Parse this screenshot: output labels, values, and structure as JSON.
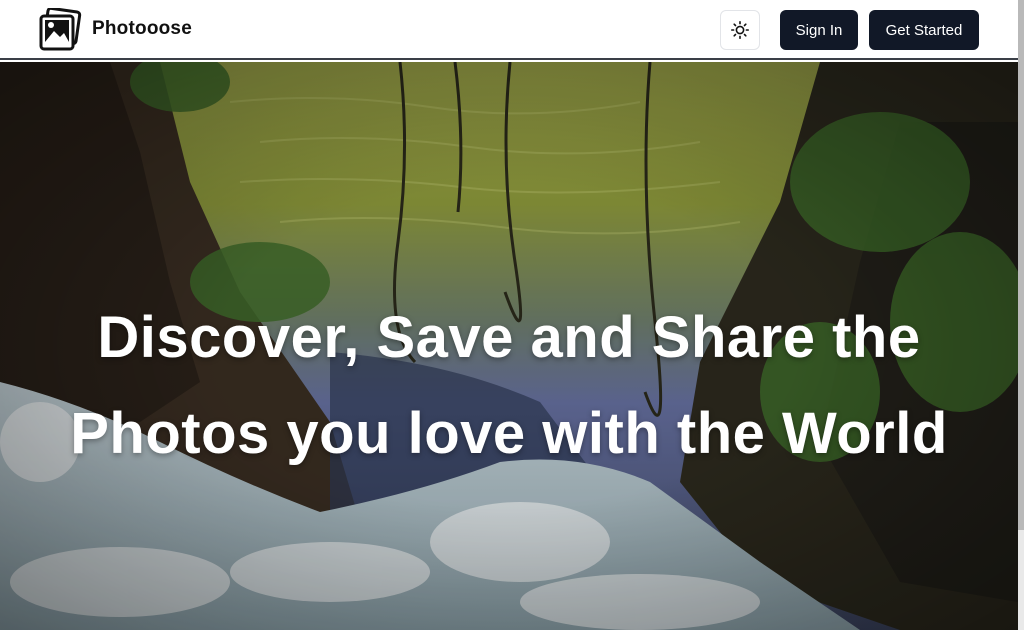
{
  "header": {
    "brand": "Photooose",
    "logo_icon": "photos-icon",
    "theme_icon": "sun-icon",
    "sign_in_label": "Sign In",
    "get_started_label": "Get Started"
  },
  "hero": {
    "headline_line1": "Discover, Save and Share the",
    "headline_line2": "Photos you love with the World",
    "background": "waterfall-photo"
  },
  "colors": {
    "button_bg": "#111827",
    "button_text": "#ffffff",
    "headline_text": "#ffffff"
  }
}
